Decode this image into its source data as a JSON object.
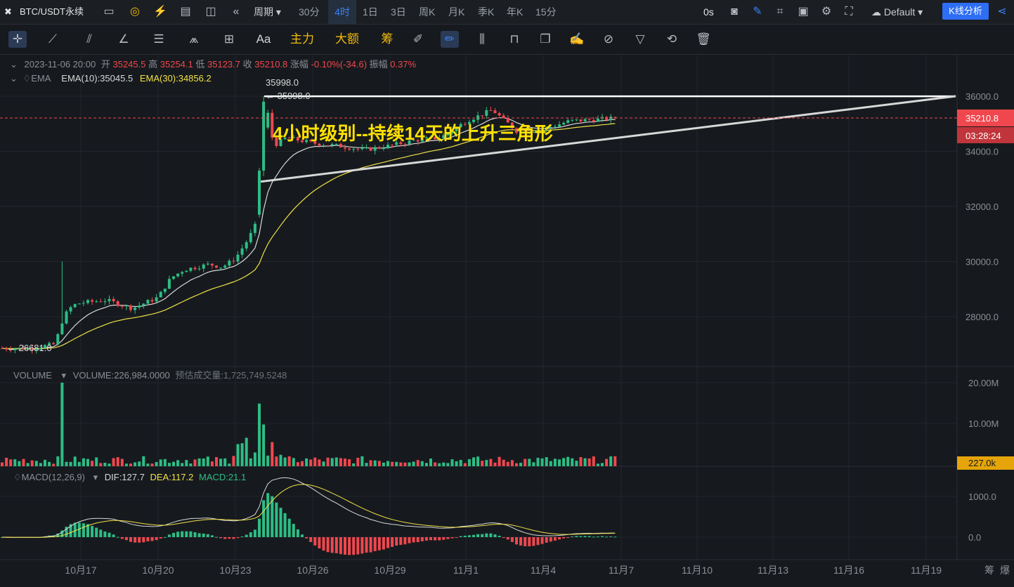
{
  "topbar": {
    "symbol": "BTC/USDT永续",
    "period_label": "周期",
    "intervals": [
      "30分",
      "4时",
      "1日",
      "3日",
      "周K",
      "月K",
      "季K",
      "年K",
      "15分"
    ],
    "active_interval": "4时",
    "timer": "0s",
    "theme": "Default",
    "analysis_button": "K线分析"
  },
  "toolbar": {
    "font_label": "Aa",
    "main_label": "主力",
    "amount_label": "大额",
    "chips_label": "筹"
  },
  "ohlc": {
    "date": "2023-11-06 20:00",
    "open_label": "开",
    "open": "35245.5",
    "high_label": "高",
    "high": "35254.1",
    "low_label": "低",
    "low": "35123.7",
    "close_label": "收",
    "close": "35210.8",
    "change_label": "涨幅",
    "change": "-0.10%(-34.6)",
    "amp_label": "振幅",
    "amp": "0.37%"
  },
  "ema": {
    "name": "EMA",
    "ema10": "EMA(10):35045.5",
    "ema30": "EMA(30):34856.2"
  },
  "volume_legend": {
    "name": "VOLUME",
    "value": "VOLUME:226,984.0000",
    "est": "预估成交量:1,725,749.5248"
  },
  "macd_legend": {
    "name": "MACD(12,26,9)",
    "dif": "DIF:127.7",
    "dea": "DEA:117.2",
    "macd": "MACD:21.1"
  },
  "annotation": "4小时级别--持续14天的上升三角形",
  "price_markers": {
    "high_mark": "35998.0",
    "high_mark_arrow": "← 35998.0",
    "low_mark": "← 26681.0",
    "last_price": "35210.8",
    "countdown": "03:28:24",
    "last_volume": "227.0k"
  },
  "colors": {
    "up": "#2ebd85",
    "down": "#f0474e",
    "ema10": "#d8d8d8",
    "ema30": "#f0e048",
    "accent": "#2d6ef5",
    "volume_badge": "#e5a50a"
  },
  "chart_data": {
    "type": "candlestick",
    "title": "BTC/USDT永续 4时",
    "x_ticks": [
      "10月17",
      "10月20",
      "10月23",
      "10月26",
      "10月29",
      "11月1",
      "11月4",
      "11月7",
      "11月10",
      "11月13",
      "11月16",
      "11月19"
    ],
    "price_axis": {
      "ticks": [
        "36000.0",
        "34000.0",
        "32000.0",
        "30000.0",
        "28000.0"
      ],
      "range": [
        25800,
        37300
      ]
    },
    "volume_axis": {
      "ticks": [
        "20.00M",
        "10.00M"
      ]
    },
    "macd_axis": {
      "ticks": [
        "1000.0",
        "0.0"
      ]
    },
    "price_path": [
      [
        "10月15 00:00",
        26850
      ],
      [
        "10月16 00:00",
        27000
      ],
      [
        "10月16 08:00",
        28000
      ],
      [
        "10月16 16:00",
        28400
      ],
      [
        "10月17 00:00",
        28500
      ],
      [
        "10月18 00:00",
        28600
      ],
      [
        "10月19 00:00",
        28300
      ],
      [
        "10月20 00:00",
        28700
      ],
      [
        "10月20 12:00",
        29400
      ],
      [
        "10月21 00:00",
        29700
      ],
      [
        "10月22 00:00",
        29900
      ],
      [
        "10月22 12:00",
        29800
      ],
      [
        "10月23 00:00",
        30100
      ],
      [
        "10月23 12:00",
        30800
      ],
      [
        "10月23 20:00",
        31400
      ],
      [
        "10月24 00:00",
        33000
      ],
      [
        "10月24 04:00",
        35900
      ],
      [
        "10月24 12:00",
        34200
      ],
      [
        "10月25 00:00",
        34500
      ],
      [
        "10月26 00:00",
        34300
      ],
      [
        "10月27 00:00",
        34200
      ],
      [
        "10月28 00:00",
        34050
      ],
      [
        "10月29 00:00",
        34200
      ],
      [
        "10月30 00:00",
        34400
      ],
      [
        "10月31 00:00",
        34500
      ],
      [
        "11月1 00:00",
        35100
      ],
      [
        "11月2 00:00",
        35500
      ],
      [
        "11月3 00:00",
        34700
      ],
      [
        "11月4 00:00",
        34800
      ],
      [
        "11月5 00:00",
        35100
      ],
      [
        "11月6 00:00",
        35150
      ],
      [
        "11月6 20:00",
        35210.8
      ]
    ],
    "triangle": {
      "resistance": 35998.0,
      "support_start": [
        "10月24 00:00",
        32900
      ],
      "support_end": [
        "11月20 00:00",
        36000
      ]
    }
  }
}
